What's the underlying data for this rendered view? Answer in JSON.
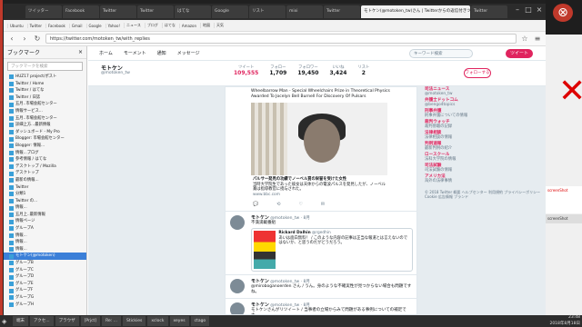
{
  "browser": {
    "tabs": [
      "ツイッター",
      "Facebook",
      "Twitter",
      "Twitter",
      "はてな",
      "Google",
      "リスト",
      "mixi",
      "Twitter",
      "Twitter"
    ],
    "active_tab_title": "モトケン(@motoken_tw)さん | Twitterからの返信付きツイート",
    "bookmarks": [
      "Ubuntu",
      "Twitter",
      "Facebook",
      "Gmail",
      "Google",
      "Yahoo!",
      "ニュース",
      "ブログ",
      "はてな",
      "Amazon",
      "地図",
      "天気"
    ],
    "url": "https://twitter.com/motoken_tw/with_replies"
  },
  "sidebar": {
    "header": "ブックマーク",
    "search_placeholder": "ブックマークを検索",
    "items": [
      {
        "label": "HUZ17 project/ポスト",
        "selected": false
      },
      {
        "label": "Twitter / Home",
        "selected": false
      },
      {
        "label": "Twitter / はてな",
        "selected": false
      },
      {
        "label": "Twitter / 日誌",
        "selected": false
      },
      {
        "label": "五月..市場会館センター",
        "selected": false
      },
      {
        "label": "情報サービス...",
        "selected": false
      },
      {
        "label": "五月..市場会館センター",
        "selected": false
      },
      {
        "label": "詳細上方...最新情報",
        "selected": false
      },
      {
        "label": "ダッシュボード - My Pro",
        "selected": false
      },
      {
        "label": "Blogger: 市場会館センター",
        "selected": false
      },
      {
        "label": "Blogger: 情報...",
        "selected": false
      },
      {
        "label": "情報...ブログ",
        "selected": false
      },
      {
        "label": "参考情報 / はてな",
        "selected": false
      },
      {
        "label": "デスクトップ / Mozilla",
        "selected": false
      },
      {
        "label": "デスクトップ",
        "selected": false
      },
      {
        "label": "最新の情報...",
        "selected": false
      },
      {
        "label": "Twitter",
        "selected": false
      },
      {
        "label": "分類1",
        "selected": false
      },
      {
        "label": "Twitter の...",
        "selected": false
      },
      {
        "label": "情報...",
        "selected": false
      },
      {
        "label": "五月上..最新情報",
        "selected": false
      },
      {
        "label": "情報ページ",
        "selected": false
      },
      {
        "label": "グループA",
        "selected": false
      },
      {
        "label": "情報...",
        "selected": false
      },
      {
        "label": "情報...",
        "selected": false
      },
      {
        "label": "情報...",
        "selected": false
      },
      {
        "label": "モトケン(@motoken)",
        "selected": true
      },
      {
        "label": "グループB",
        "selected": false
      },
      {
        "label": "グループC",
        "selected": false
      },
      {
        "label": "グループD",
        "selected": false
      },
      {
        "label": "グループE",
        "selected": false
      },
      {
        "label": "グループF",
        "selected": false
      },
      {
        "label": "グループG",
        "selected": false
      },
      {
        "label": "グループH",
        "selected": false
      }
    ]
  },
  "twitter": {
    "nav": [
      "ホーム",
      "モーメント",
      "通知",
      "メッセージ"
    ],
    "search_placeholder": "キーワード検索",
    "tweet_button": "ツイート",
    "profile_name": "モトケン",
    "profile_handle": "@motoken_tw",
    "stats": [
      {
        "label": "ツイート",
        "value": "109,555",
        "active": true
      },
      {
        "label": "フォロー",
        "value": "1,709",
        "active": false
      },
      {
        "label": "フォロワー",
        "value": "19,450",
        "active": false
      },
      {
        "label": "いいね",
        "value": "3,424",
        "active": false
      },
      {
        "label": "リスト",
        "value": "2",
        "active": false
      }
    ],
    "follow_button": "フォローする",
    "card_text": "Wheelbarrow Man - Special Wheelchairs Prize in Theoretical Physics Awarded To Jocelyn Bell Burnell For Discovery Of Pulsars",
    "caption_title": "パルサー発見の功績でノーベル賞の栄誉を受けた女性",
    "caption_body": "当時大学院生であった彼女は天体からの電波パルスを発見したが、ノーベル賞は指導教官に授与された。",
    "caption_url": "www.bbc.com",
    "tweets": [
      {
        "name": "モトケン",
        "handle": "@motoken_tw · 8月",
        "text": "不満満載番組",
        "quote_name": "Rickard Dalhin",
        "quote_handle": "@rgedhin",
        "quote_text": "あいは面白無料！ / このような内容の記事は正当な報道とは言えないのではないか、と思うのだがどうだろう。"
      },
      {
        "name": "モトケン",
        "handle": "@motoken_tw · 8月",
        "text": "@miroboganoerden さん / うん。身のような不確実性が見つからない場合も問題ですね。"
      },
      {
        "name": "モトケン",
        "handle": "@motoken_tw · 8月",
        "text": "モトケンさんがリツイート / 当事者の立場からみて問題がある事例についての補足です。"
      }
    ]
  },
  "rightcol": [
    {
      "title": "司法ニュース",
      "sub": "@motoken_tw"
    },
    {
      "title": "弁護士ドットコム",
      "sub": "@bengo4topics"
    },
    {
      "title": "刑事弁護",
      "sub": "刑事弁護についての情報"
    },
    {
      "title": "裁判ウォッチ",
      "sub": "裁判傍聴の記録"
    },
    {
      "title": "法律相談",
      "sub": "法律相談の情報"
    },
    {
      "title": "判例速報",
      "sub": "最新判例の紹介"
    },
    {
      "title": "ロースクール",
      "sub": "法科大学院の情報"
    },
    {
      "title": "司法試験",
      "sub": "司法試験の情報"
    },
    {
      "title": "アメリカ法",
      "sub": "海外の法律事情"
    }
  ],
  "footer_text": "© 2018 Twitter 概要 ヘルプセンター 利用規約 プライバシーポリシー Cookie 広告情報 ブランド",
  "right_panel": {
    "log": "screenShot",
    "screenshot_label": "screenShot"
  },
  "taskbar": {
    "items": [
      "端末",
      "アクセ...",
      "ブラウザ",
      "[Prjct]",
      "Re: ...",
      "Stickies",
      "xclock",
      "xeyes",
      "ctago"
    ],
    "time": "23:48",
    "date": "2018年8月18日"
  }
}
